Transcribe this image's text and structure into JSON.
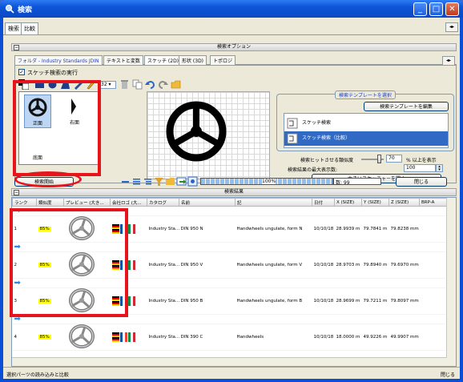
{
  "window": {
    "title": "検索"
  },
  "top_tabs": [
    "検索",
    "比較"
  ],
  "search_options_header": "検索オプション",
  "sub_tabs": [
    "フォルダ - Industry Standards JDIN",
    "テキストと変数",
    "スケッチ (2D)",
    "形状 (3D)",
    "トポロジ"
  ],
  "sketch": {
    "enable_label": "スケッチ検索の実行",
    "enabled": true,
    "line_width": "32",
    "views": {
      "front": "正面",
      "right": "右面",
      "bottom": "底面"
    }
  },
  "templates": {
    "group_label": "検索テンプレートを選択",
    "edit_button": "検索テンプレートを編集",
    "items": [
      {
        "label": "スケッチ検索",
        "selected": false
      },
      {
        "label": "スケッチ検索（比較）",
        "selected": true
      }
    ]
  },
  "similarity": {
    "label": "検索ヒットさせる類似度",
    "value": "70",
    "suffix": "% 以上を表示"
  },
  "max_results": {
    "label": "検索結果の最大表示数:",
    "value": "100"
  },
  "open_large_sketcher": "大きいスケッチャーを開く",
  "search_button": "検索開始",
  "progress": {
    "percent": 100,
    "label": "100%",
    "count_label": "数: 99"
  },
  "close_button": "閉じる",
  "results": {
    "header": "検索結果",
    "columns": [
      "ランク",
      "類似度",
      "プレビュー (大き...",
      "会社ロゴ (大...",
      "カタログ",
      "名前",
      "記",
      "日付",
      "X (SIZE)",
      "Y (SIZE)",
      "Z (SIZE)",
      "BRP-A"
    ],
    "rows": [
      {
        "rank": "1",
        "similarity": "85%",
        "catalog": "Industry Sta...",
        "name": "DIN 950 N",
        "desc": "Handwheels ungulate, form N",
        "date": "10/10/18",
        "x": "28.9939 m",
        "y": "79.7841 m",
        "z": "79.8238 mm"
      },
      {
        "rank": "2",
        "similarity": "85%",
        "catalog": "Industry Sta...",
        "name": "DIN 950 V",
        "desc": "Handwheels ungulate, form V",
        "date": "10/10/18",
        "x": "28.9703 m",
        "y": "79.8940 m",
        "z": "79.6970 mm"
      },
      {
        "rank": "3",
        "similarity": "85%",
        "catalog": "Industry Sta...",
        "name": "DIN 950 B",
        "desc": "Handwheels ungulate, form B",
        "date": "10/10/18",
        "x": "28.9699 m",
        "y": "79.7211 m",
        "z": "79.8097 mm"
      },
      {
        "rank": "4",
        "similarity": "85%",
        "catalog": "Industry Sta...",
        "name": "DIN 390 C",
        "desc": "Handwheels",
        "date": "10/10/18",
        "x": "18.0000 m",
        "y": "49.9226 m",
        "z": "49.9907 mm"
      }
    ]
  },
  "status_bar": {
    "text": "選択パーツの読み込みと比較",
    "close": "閉じる"
  },
  "colors": {
    "accent": "#e8141c",
    "title_bar": "#0c54d8",
    "highlight": "#ffff00",
    "selection": "#316ac5"
  }
}
